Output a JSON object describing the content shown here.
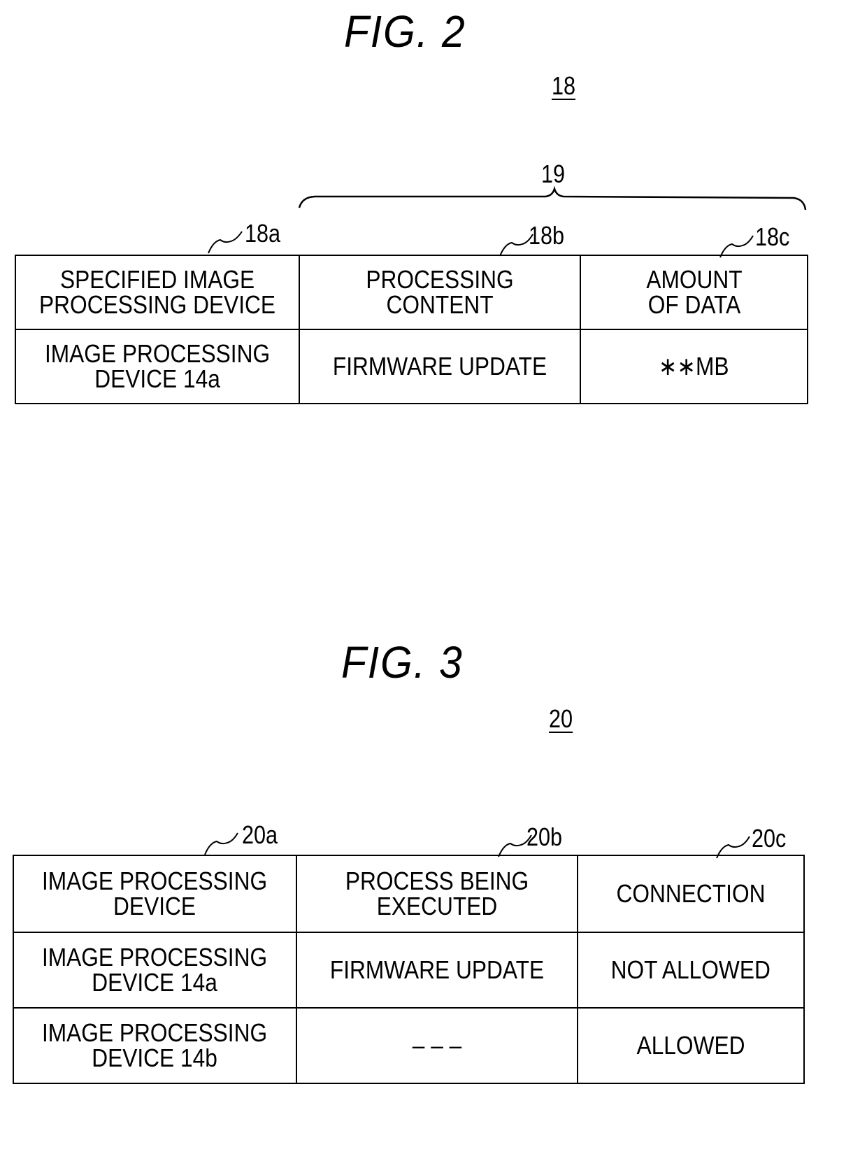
{
  "figures": [
    {
      "title": "FIG. 2",
      "reference": "18",
      "group_reference": "19",
      "column_refs": [
        "18a",
        "18b",
        "18c"
      ],
      "headers": [
        "SPECIFIED IMAGE\nPROCESSING DEVICE",
        "PROCESSING\nCONTENT",
        "AMOUNT\nOF DATA"
      ],
      "rows": [
        [
          "IMAGE PROCESSING\nDEVICE 14a",
          "FIRMWARE UPDATE",
          "∗∗MB"
        ]
      ]
    },
    {
      "title": "FIG. 3",
      "reference": "20",
      "column_refs": [
        "20a",
        "20b",
        "20c"
      ],
      "headers": [
        "IMAGE PROCESSING\nDEVICE",
        "PROCESS BEING\nEXECUTED",
        "CONNECTION"
      ],
      "rows": [
        [
          "IMAGE PROCESSING\nDEVICE 14a",
          "FIRMWARE UPDATE",
          "NOT ALLOWED"
        ],
        [
          "IMAGE PROCESSING\nDEVICE 14b",
          "– – –",
          "ALLOWED"
        ]
      ]
    }
  ]
}
